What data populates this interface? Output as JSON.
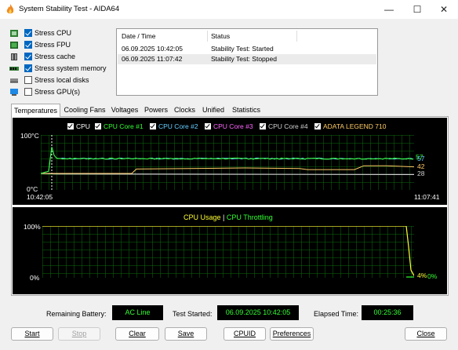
{
  "window": {
    "title": "System Stability Test - AIDA64"
  },
  "stress_options": [
    {
      "label": "Stress CPU",
      "checked": true,
      "icon": "cpu-icon"
    },
    {
      "label": "Stress FPU",
      "checked": true,
      "icon": "fpu-icon"
    },
    {
      "label": "Stress cache",
      "checked": true,
      "icon": "cache-icon"
    },
    {
      "label": "Stress system memory",
      "checked": true,
      "icon": "memory-icon"
    },
    {
      "label": "Stress local disks",
      "checked": false,
      "icon": "disk-icon"
    },
    {
      "label": "Stress GPU(s)",
      "checked": false,
      "icon": "gpu-icon"
    }
  ],
  "log": {
    "headers": [
      "Date / Time",
      "Status"
    ],
    "rows": [
      {
        "datetime": "06.09.2025 10:42:05",
        "status": "Stability Test: Started"
      },
      {
        "datetime": "06.09.2025 11:07:42",
        "status": "Stability Test: Stopped"
      }
    ]
  },
  "tabs": [
    {
      "label": "Temperatures",
      "active": true
    },
    {
      "label": "Cooling Fans",
      "active": false
    },
    {
      "label": "Voltages",
      "active": false
    },
    {
      "label": "Powers",
      "active": false
    },
    {
      "label": "Clocks",
      "active": false
    },
    {
      "label": "Unified",
      "active": false
    },
    {
      "label": "Statistics",
      "active": false
    }
  ],
  "temperature_graph": {
    "legend": [
      {
        "label": "CPU",
        "color": "#ffffff"
      },
      {
        "label": "CPU Core #1",
        "color": "#33ff33"
      },
      {
        "label": "CPU Core #2",
        "color": "#66ccff"
      },
      {
        "label": "CPU Core #3",
        "color": "#ff66ff"
      },
      {
        "label": "CPU Core #4",
        "color": "#d0d0d0"
      },
      {
        "label": "ADATA LEGEND 710",
        "color": "#ffcc66"
      }
    ],
    "y_top_label": "100°C",
    "y_bottom_label": "0°C",
    "x_start_label": "10:42:05",
    "x_end_label": "11:07:41",
    "end_values": [
      {
        "label": "57",
        "color": "#33ff33"
      },
      {
        "label": "57",
        "color": "#66ccff"
      },
      {
        "label": "42",
        "color": "#ffcc66"
      },
      {
        "label": "28",
        "color": "#d0d0d0"
      }
    ]
  },
  "cpu_graph": {
    "title_usage": "CPU Usage",
    "title_sep": "|",
    "title_throttling": "CPU Throttling",
    "usage_color": "#ffff33",
    "throttling_color": "#33ff33",
    "y_top_label": "100%",
    "y_bottom_label": "0%",
    "end_usage": "4%",
    "end_throttling": "0%"
  },
  "status": {
    "battery_label": "Remaining Battery:",
    "battery_value": "AC Line",
    "started_label": "Test Started:",
    "started_value": "06.09.2025 10:42:05",
    "elapsed_label": "Elapsed Time:",
    "elapsed_value": "00:25:36"
  },
  "buttons": {
    "start": "Start",
    "stop": "Stop",
    "clear": "Clear",
    "save": "Save",
    "cpuid": "CPUID",
    "preferences": "Preferences",
    "close": "Close"
  },
  "chart_data": [
    {
      "type": "line",
      "title": "",
      "xlabel": "",
      "ylabel": "",
      "ylim": [
        0,
        100
      ],
      "x": [
        "10:42:05",
        "11:07:41"
      ],
      "series": [
        {
          "name": "CPU Core #1",
          "values": [
            57,
            57
          ]
        },
        {
          "name": "CPU Core #2",
          "values": [
            57,
            57
          ]
        },
        {
          "name": "ADATA LEGEND 710",
          "values": [
            42,
            42
          ]
        },
        {
          "name": "CPU Core #4",
          "values": [
            28,
            28
          ]
        }
      ]
    },
    {
      "type": "line",
      "title": "CPU Usage | CPU Throttling",
      "ylim": [
        0,
        100
      ],
      "series": [
        {
          "name": "CPU Usage",
          "values": [
            100,
            4
          ]
        },
        {
          "name": "CPU Throttling",
          "values": [
            0,
            0
          ]
        }
      ]
    }
  ]
}
